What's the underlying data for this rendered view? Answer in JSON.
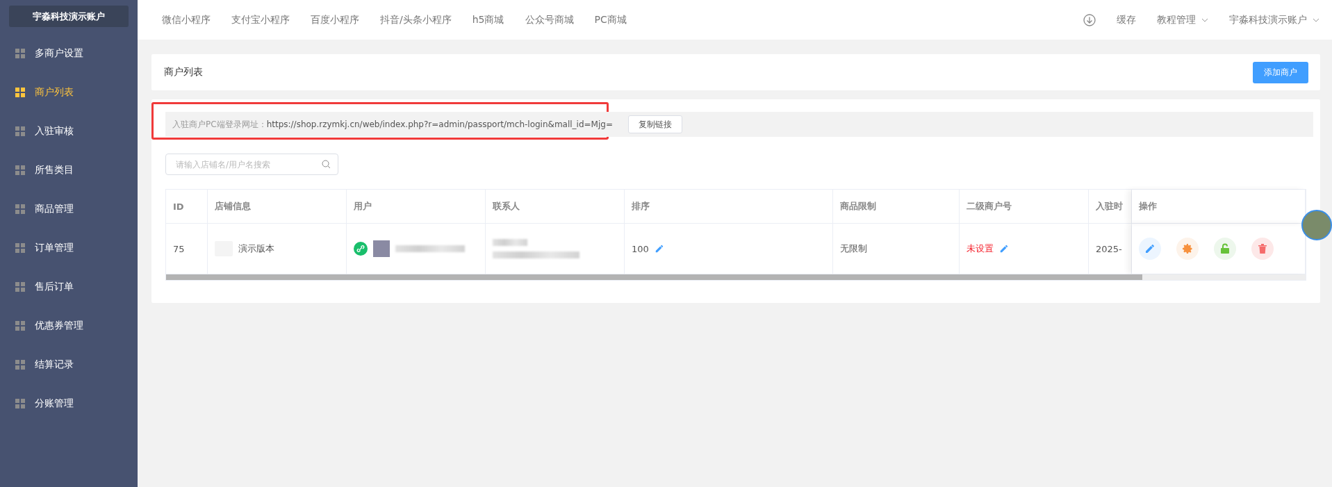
{
  "sidebar": {
    "account": "宇淼科技演示账户",
    "items": [
      {
        "label": "多商户设置",
        "selected": false
      },
      {
        "label": "商户列表",
        "selected": true
      },
      {
        "label": "入驻审核",
        "selected": false
      },
      {
        "label": "所售类目",
        "selected": false
      },
      {
        "label": "商品管理",
        "selected": false
      },
      {
        "label": "订单管理",
        "selected": false
      },
      {
        "label": "售后订单",
        "selected": false
      },
      {
        "label": "优惠券管理",
        "selected": false
      },
      {
        "label": "结算记录",
        "selected": false
      },
      {
        "label": "分账管理",
        "selected": false
      }
    ]
  },
  "topbar": {
    "tabs": [
      "微信小程序",
      "支付宝小程序",
      "百度小程序",
      "抖音/头条小程序",
      "h5商城",
      "公众号商城",
      "PC商城"
    ],
    "actions": [
      {
        "label": "缓存",
        "dropdown": false
      },
      {
        "label": "教程管理",
        "dropdown": true
      },
      {
        "label": "宇淼科技演示账户",
        "dropdown": true
      }
    ]
  },
  "header": {
    "title": "商户列表",
    "button": "添加商户"
  },
  "login_url": {
    "label": "入驻商户PC端登录网址：",
    "url": "https://shop.rzymkj.cn/web/index.php?r=admin/passport/mch-login&mall_id=Mjg=",
    "button": "复制链接"
  },
  "search": {
    "placeholder": "请输入店铺名/用户名搜索"
  },
  "table": {
    "columns": [
      "ID",
      "店铺信息",
      "用户",
      "联系人",
      "排序",
      "商品限制",
      "二级商户号",
      "入驻时",
      "操作"
    ],
    "rows": [
      {
        "id": "75",
        "store": "演示版本",
        "sort": "100",
        "limit": "无限制",
        "sub_merchant": "未设置",
        "join_time": "2025-"
      }
    ]
  }
}
